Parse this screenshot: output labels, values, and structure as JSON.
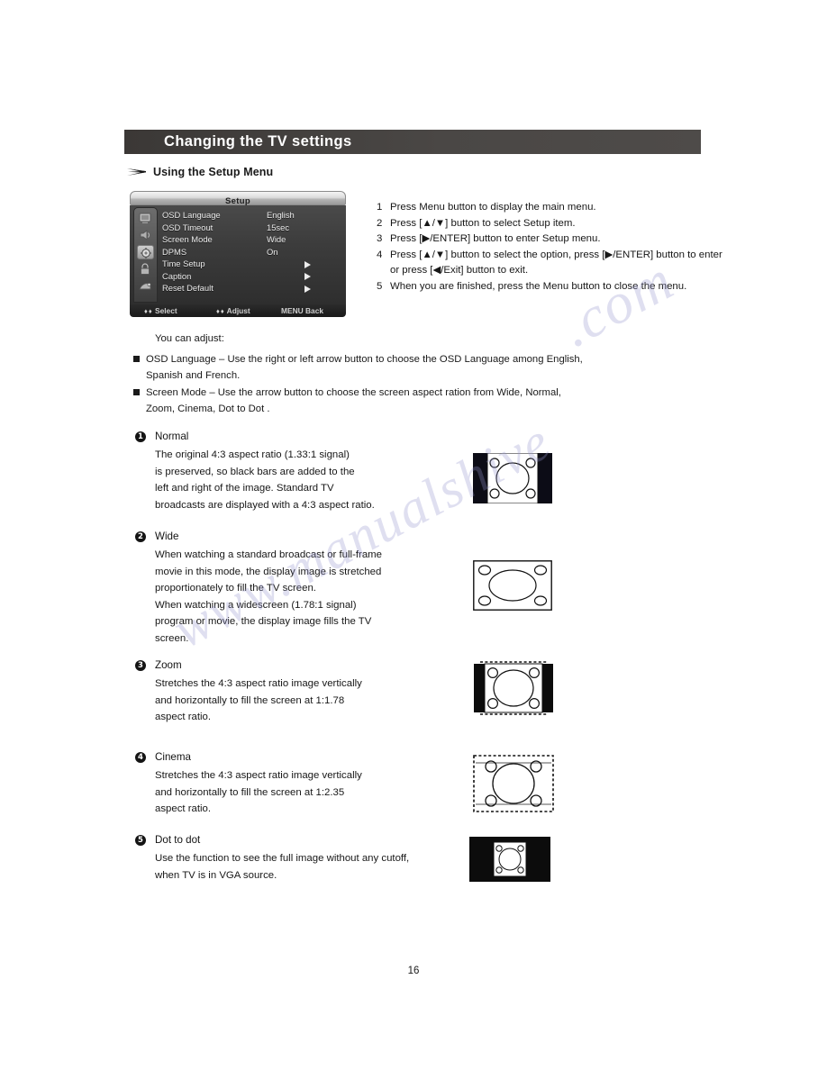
{
  "header": {
    "title": "Changing the TV settings"
  },
  "section": {
    "heading": "Using the Setup Menu"
  },
  "osd": {
    "title": "Setup",
    "rows": [
      {
        "label": "OSD  Language",
        "value": "English",
        "arrow": false
      },
      {
        "label": "OSD Timeout",
        "value": "15sec",
        "arrow": false
      },
      {
        "label": "Screen  Mode",
        "value": "Wide",
        "arrow": false
      },
      {
        "label": "DPMS",
        "value": "On",
        "arrow": false
      },
      {
        "label": "Time Setup",
        "value": "",
        "arrow": true
      },
      {
        "label": "Caption",
        "value": "",
        "arrow": true
      },
      {
        "label": "Reset Default",
        "value": "",
        "arrow": true
      }
    ],
    "footer": {
      "select_glyph": "♦♦",
      "select": "Select",
      "adjust_glyph": "♦♦",
      "adjust": "Adjust",
      "back": "MENU  Back"
    },
    "sidebar_icons": [
      "picture-icon",
      "sound-icon",
      "setup-icon",
      "lock-icon",
      "source-icon"
    ],
    "selected_icon_index": 2
  },
  "steps": [
    {
      "num": "1",
      "text": "Press Menu button to display the main menu."
    },
    {
      "num": "2",
      "text": "Press [▲/▼] button to select Setup item."
    },
    {
      "num": "3",
      "text": "Press [▶/ENTER] button to enter Setup menu."
    },
    {
      "num": "4",
      "text": "Press [▲/▼] button to select the option, press [▶/ENTER] button to enter",
      "text2": "or press [◀/Exit] button to exit."
    },
    {
      "num": "5",
      "text": "When you are finished, press the Menu button to close the menu."
    }
  ],
  "adjust": {
    "intro": "You can adjust:",
    "bullets": [
      {
        "line1": "OSD Language – Use the right or left arrow button to choose the OSD Language among English,",
        "line2": "Spanish and French."
      },
      {
        "line1": "Screen Mode –   Use the arrow button to choose the screen aspect ration from Wide,  Normal,",
        "line2": "Zoom,  Cinema,  Dot to Dot ."
      }
    ]
  },
  "modes": [
    {
      "num": "❶",
      "num_plain": "1",
      "title": "Normal",
      "body": "The original 4:3 aspect ratio (1.33:1 signal)\nis preserved, so black bars are added to the\nleft and right of the image. Standard TV\nbroadcasts are displayed with a 4:3 aspect ratio.",
      "diagram": "normal-aspect-diagram"
    },
    {
      "num": "❷",
      "num_plain": "2",
      "title": "Wide",
      "body": "When watching a standard broadcast or full-frame\nmovie in this mode, the display image is stretched\nproportionately to fill the TV screen.\nWhen watching a widescreen (1.78:1 signal)\nprogram or movie, the display image fills the TV\nscreen.",
      "diagram": "wide-aspect-diagram"
    },
    {
      "num": "❸",
      "num_plain": "3",
      "title": "Zoom",
      "body": "Stretches the 4:3 aspect ratio image vertically\nand horizontally to fill the screen at 1:1.78\naspect ratio.",
      "diagram": "zoom-aspect-diagram"
    },
    {
      "num": "❹",
      "num_plain": "4",
      "title": "Cinema",
      "body": "Stretches the 4:3 aspect ratio image vertically\nand horizontally to fill the screen at 1:2.35\naspect ratio.",
      "diagram": "cinema-aspect-diagram"
    },
    {
      "num": "❺",
      "num_plain": "5",
      "title": "Dot  to  dot",
      "body": "Use the function to see the full image without any cutoff,\nwhen TV is in VGA source.",
      "diagram": "dot-to-dot-aspect-diagram"
    }
  ],
  "page_number": "16",
  "watermark": {
    "part1": "www.manualshive",
    "part2": ".com"
  },
  "colors": {
    "header_band": "#443f3d",
    "text": "#171717",
    "osd_body": "#3c3c3c",
    "osd_text": "#e9e9e9"
  }
}
